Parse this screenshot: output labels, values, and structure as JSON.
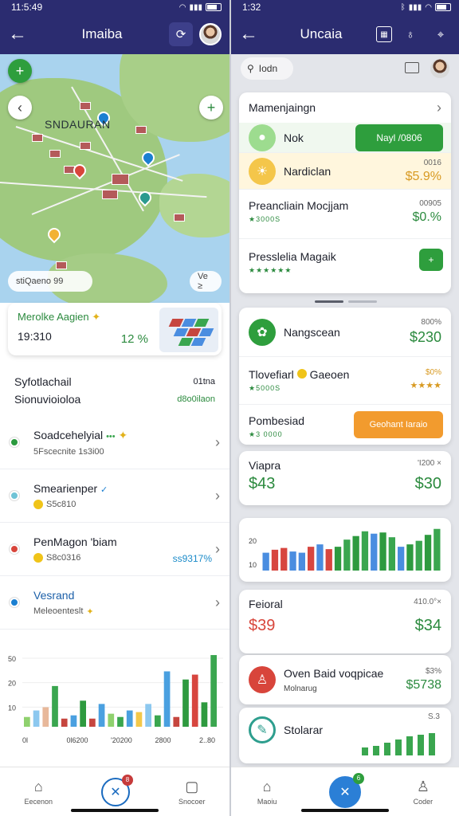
{
  "left": {
    "status": {
      "time": "11:5:49"
    },
    "appbar": {
      "title": "Imaiba"
    },
    "map": {
      "label": "SNDAURAN",
      "pill_left": "stiQaeno  99",
      "pill_right": "Ve ≥"
    },
    "metric_card": {
      "title": "Merolke Aagien",
      "value": "19:310",
      "percent": "12 %"
    },
    "summary": {
      "row1_label": "Syfotlachail",
      "row1_value": "01tna",
      "row2_label": "Sionuvioioloa",
      "row2_value": "d8o0ilaon"
    },
    "list": [
      {
        "title": "Soadcehelyial",
        "sub": "5Fscecnite 1s3i00",
        "value": "",
        "color": "#2b9a3e"
      },
      {
        "title": "Smearienper",
        "sub": "S5c810",
        "value": "",
        "color": "#6fc3d6"
      },
      {
        "title": "PenMagon 'biam",
        "sub": "S8c0316",
        "value": "ss9317%",
        "color": "#d8453b"
      },
      {
        "title": "Vesrand",
        "sub": "Meleoenteslt",
        "value": "",
        "color": "#1b7fd1"
      }
    ],
    "chart_data": {
      "type": "bar",
      "yticks": [
        "50",
        "20",
        "10"
      ],
      "xticks": [
        "0l",
        "0l6200",
        "'20200",
        "2800",
        "2..80"
      ],
      "values": [
        12,
        20,
        24,
        50,
        10,
        14,
        32,
        10,
        28,
        16,
        12,
        20,
        18,
        28,
        14,
        68,
        12,
        58,
        64,
        30,
        88
      ],
      "colors": [
        "#8fd16e",
        "#8cc8ef",
        "#e8b89a",
        "#3aa64f",
        "#c6463f",
        "#4aa0e0",
        "#2e9a3f",
        "#c6463f",
        "#4aa0e0",
        "#8fd16e",
        "#3aa64f",
        "#4aa0e0",
        "#f3c84a",
        "#8cc8ef",
        "#3aa64f",
        "#4aa0e0",
        "#c6463f",
        "#2e9a3f",
        "#d7463f",
        "#2e9a3f",
        "#3aa64f"
      ]
    },
    "nav": {
      "item1": "Eecenon",
      "item3": "Snocoer",
      "badge": "8"
    }
  },
  "right": {
    "status": {
      "time": "1:32"
    },
    "appbar": {
      "title": "Uncaia"
    },
    "search": {
      "placeholder": "Iodn"
    },
    "card1": {
      "header": "Mamenjaingn",
      "row1": {
        "title": "Nok",
        "button": "Nayl /0806"
      },
      "row2": {
        "title": "Nardiclan",
        "small": "0016",
        "big": "$5.9%"
      },
      "row3": {
        "title": "Preancliain Mocjjam",
        "sub": "★3000S",
        "small": "00905",
        "big": "$0.%"
      },
      "row4": {
        "title": "Presslelia Magaik",
        "sub": "★★★★★★"
      }
    },
    "card2": {
      "row1": {
        "title": "Nangscean",
        "small": "800%",
        "big": "$230"
      },
      "row2": {
        "title": "Tlovefiarl",
        "title2": "Gaeoen",
        "sub": "★5000S",
        "small": "$0%",
        "stars": "★★★★"
      },
      "row3": {
        "title": "Pombesiad",
        "sub": "★3 0000",
        "button": "Geohant Iaraio"
      }
    },
    "card3": {
      "label": "Viapra",
      "small": "'I200 ×",
      "left_value": "$43",
      "right_value": "$30"
    },
    "chart_data": {
      "type": "bar",
      "yticks": [
        "20",
        "10"
      ],
      "values": [
        30,
        35,
        38,
        32,
        30,
        40,
        44,
        36,
        40,
        52,
        58,
        66,
        62,
        64,
        56,
        40,
        44,
        50,
        60,
        70
      ],
      "colors": [
        "#4a8de0",
        "#d7463f",
        "#d7463f",
        "#4a8de0",
        "#4a8de0",
        "#d7463f",
        "#4a8de0",
        "#d7463f",
        "#2e9a3f",
        "#3aa64f",
        "#2e9a3f",
        "#3aa64f",
        "#4a8de0",
        "#2e9a3f",
        "#3aa64f",
        "#4a8de0",
        "#2e9a3f",
        "#3aa64f",
        "#2e9a3f",
        "#3aa64f"
      ]
    },
    "card4": {
      "label": "Feioral",
      "small": "410.0°×",
      "left_value": "$39",
      "right_value": "$34"
    },
    "card5": {
      "title": "Oven Baid voqpicae",
      "sub": "Molnarug",
      "small": "$3%",
      "big": "$5738"
    },
    "card6": {
      "title": "Stolarar",
      "small": "S.3"
    },
    "nav": {
      "item1": "Maoiu",
      "item3": "Coder",
      "badge": "6"
    }
  }
}
